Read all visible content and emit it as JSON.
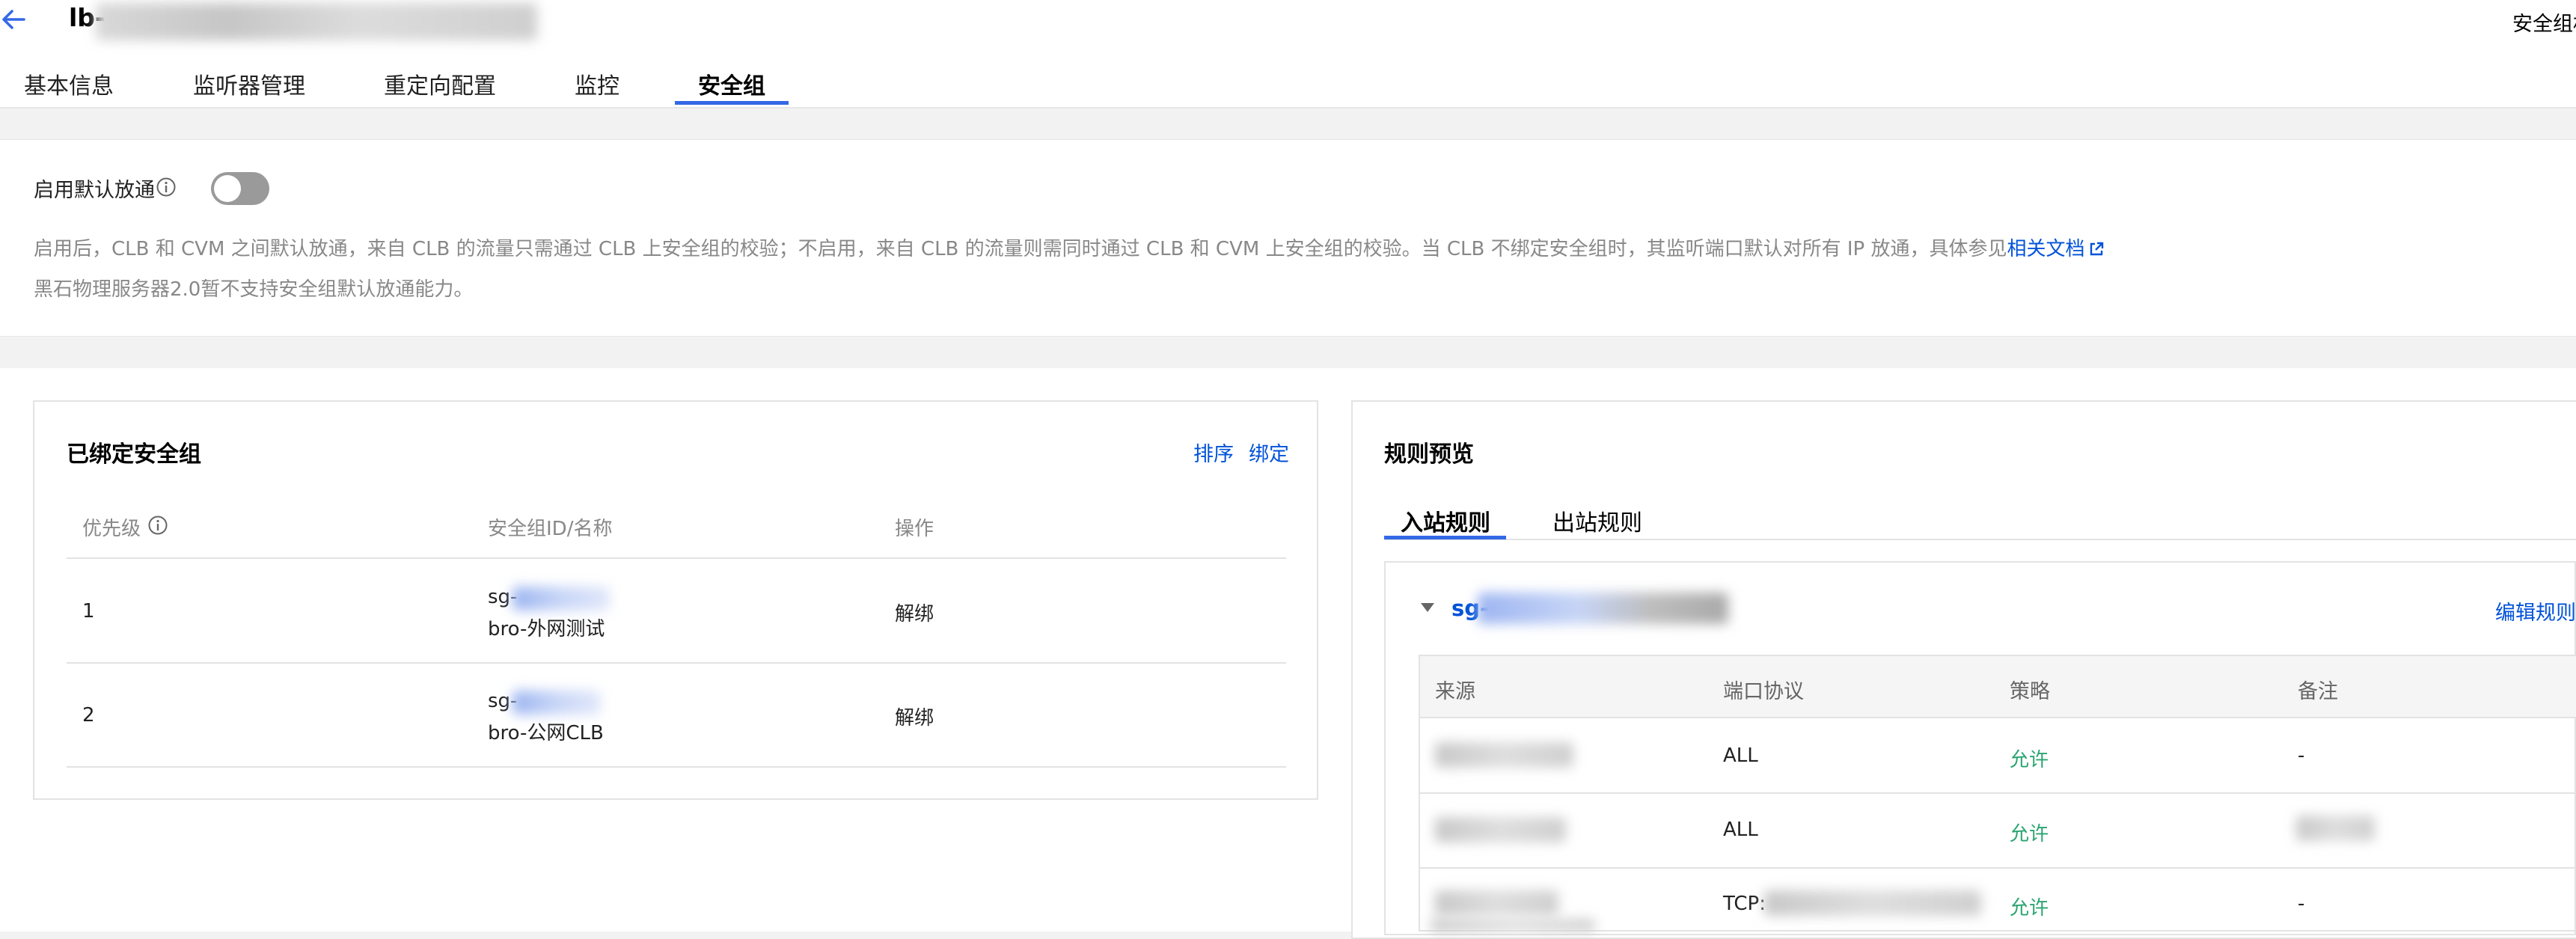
{
  "header": {
    "title_prefix": "lb-",
    "top_right_text": "安全组相"
  },
  "tabs": [
    {
      "label": "基本信息"
    },
    {
      "label": "监听器管理"
    },
    {
      "label": "重定向配置"
    },
    {
      "label": "监控"
    },
    {
      "label": "安全组",
      "active": true
    }
  ],
  "default_allow": {
    "label": "启用默认放通",
    "enabled": false,
    "description_line1": "启用后，CLB 和 CVM 之间默认放通，来自 CLB 的流量只需通过 CLB 上安全组的校验；不启用，来自 CLB 的流量则需同时通过 CLB 和 CVM 上安全组的校验。当 CLB 不绑定安全组时，其监听端口默认对所有 IP 放通，具体参见",
    "description_link": "相关文档",
    "description_line2": "黑石物理服务器2.0暂不支持安全组默认放通能力。"
  },
  "bound_groups": {
    "title": "已绑定安全组",
    "sort_label": "排序",
    "bind_label": "绑定",
    "columns": [
      "优先级",
      "安全组ID/名称",
      "操作"
    ],
    "rows": [
      {
        "priority": "1",
        "sg_id_prefix": "sg-",
        "sg_name": "bro-外网测试",
        "action": "解绑"
      },
      {
        "priority": "2",
        "sg_id_prefix": "sg-",
        "sg_name": "bro-公网CLB",
        "action": "解绑"
      }
    ]
  },
  "rules_preview": {
    "title": "规则预览",
    "tabs": [
      {
        "label": "入站规则",
        "active": true
      },
      {
        "label": "出站规则"
      }
    ],
    "sg_prefix": "sg-",
    "edit_label": "编辑规则",
    "columns": [
      "来源",
      "端口协议",
      "策略",
      "备注"
    ],
    "rows": [
      {
        "port": "ALL",
        "policy": "允许",
        "note": "-"
      },
      {
        "port": "ALL",
        "policy": "允许",
        "note": ""
      },
      {
        "port": "TCP:",
        "policy": "允许",
        "note": "-"
      }
    ]
  },
  "colors": {
    "accent": "#0052d9",
    "tab_underline": "#3368e6",
    "allow": "#2ba471"
  }
}
